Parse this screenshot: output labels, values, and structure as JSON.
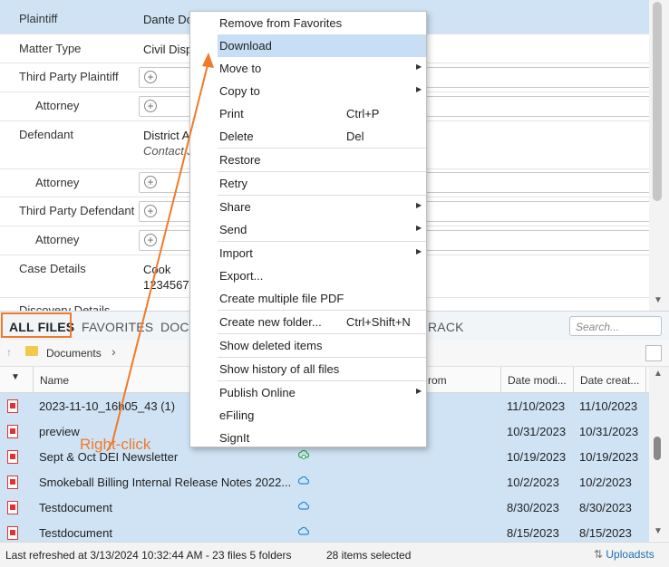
{
  "details": {
    "plaintiff_label": "Plaintiff",
    "plaintiff_value": "Dante Do",
    "matter_type_label": "Matter Type",
    "matter_type_value": "Civil Disp",
    "third_party_plaintiff_label": "Third Party Plaintiff",
    "attorney_label": "Attorney",
    "defendant_label": "Defendant",
    "defendant_value": "District A",
    "defendant_contact": "Contact J",
    "third_party_defendant_label": "Third Party Defendant",
    "case_details_label": "Case Details",
    "case_details_line1": "Cook",
    "case_details_line2": "12345678",
    "discovery_label": "Discovery Details",
    "add_icon": "plus-circle-icon"
  },
  "tabs": {
    "all_files": "ALL FILES",
    "favorites": "FAVORITES",
    "docu_partial": "DOCU",
    "track_partial": "RACK",
    "search_placeholder": "Search..."
  },
  "breadcrumb": {
    "folder": "Documents"
  },
  "table": {
    "columns": {
      "name": "Name",
      "from": "rom",
      "date_modified": "Date modi...",
      "date_created": "Date creat..."
    },
    "rows": [
      {
        "name": "2023-11-10_16h05_43 (1)",
        "modified": "11/10/2023",
        "created": "11/10/2023",
        "icon": "pdf-icon",
        "sync": ""
      },
      {
        "name": "preview",
        "modified": "10/31/2023",
        "created": "10/31/2023",
        "icon": "pdf-icon",
        "sync": ""
      },
      {
        "name": "Sept & Oct DEI Newsletter",
        "modified": "10/19/2023",
        "created": "10/19/2023",
        "icon": "pdf-icon",
        "sync": "cloud-sync-icon"
      },
      {
        "name": "Smokeball Billing Internal Release Notes 2022...",
        "modified": "10/2/2023",
        "created": "10/2/2023",
        "icon": "pdf-icon",
        "sync": "cloud-icon"
      },
      {
        "name": "Testdocument",
        "modified": "8/30/2023",
        "created": "8/30/2023",
        "icon": "pdf-icon",
        "sync": "cloud-icon"
      },
      {
        "name": "Testdocument",
        "modified": "8/15/2023",
        "created": "8/15/2023",
        "icon": "pdf-icon",
        "sync": "cloud-icon"
      }
    ]
  },
  "status": {
    "left": "Last refreshed at 3/13/2024 10:32:44 AM  -  23 files  5 folders",
    "mid": "28 items selected",
    "right": "Uploadsts"
  },
  "menu": {
    "items": [
      {
        "label": "Remove from Favorites",
        "shortcut": "",
        "submenu": false
      },
      {
        "label": "Download",
        "shortcut": "",
        "submenu": false,
        "highlighted": true
      },
      {
        "label": "Move to",
        "shortcut": "",
        "submenu": true
      },
      {
        "label": "Copy to",
        "shortcut": "",
        "submenu": true
      },
      {
        "label": "Print",
        "shortcut": "Ctrl+P",
        "submenu": false
      },
      {
        "label": "Delete",
        "shortcut": "Del",
        "submenu": false
      },
      {
        "label": "Restore",
        "shortcut": "",
        "submenu": false
      },
      {
        "label": "Retry",
        "shortcut": "",
        "submenu": false
      },
      {
        "label": "Share",
        "shortcut": "",
        "submenu": true
      },
      {
        "label": "Send",
        "shortcut": "",
        "submenu": true
      },
      {
        "label": "Import",
        "shortcut": "",
        "submenu": true
      },
      {
        "label": "Export...",
        "shortcut": "",
        "submenu": false
      },
      {
        "label": "Create multiple file PDF",
        "shortcut": "",
        "submenu": false
      },
      {
        "label": "Create new folder...",
        "shortcut": "Ctrl+Shift+N",
        "submenu": false
      },
      {
        "label": "Show deleted items",
        "shortcut": "",
        "submenu": false
      },
      {
        "label": "Show history of all files",
        "shortcut": "",
        "submenu": false
      },
      {
        "label": "Publish Online",
        "shortcut": "",
        "submenu": true
      },
      {
        "label": "eFiling",
        "shortcut": "",
        "submenu": false
      },
      {
        "label": "SignIt",
        "shortcut": "",
        "submenu": false
      }
    ]
  },
  "annotation": {
    "label": "Right-click",
    "color": "#f07a2a"
  },
  "colors": {
    "selection": "#cfe3f5",
    "menu_highlight": "#c8def4",
    "accent": "#f07a2a",
    "link": "#1d6fb8"
  }
}
